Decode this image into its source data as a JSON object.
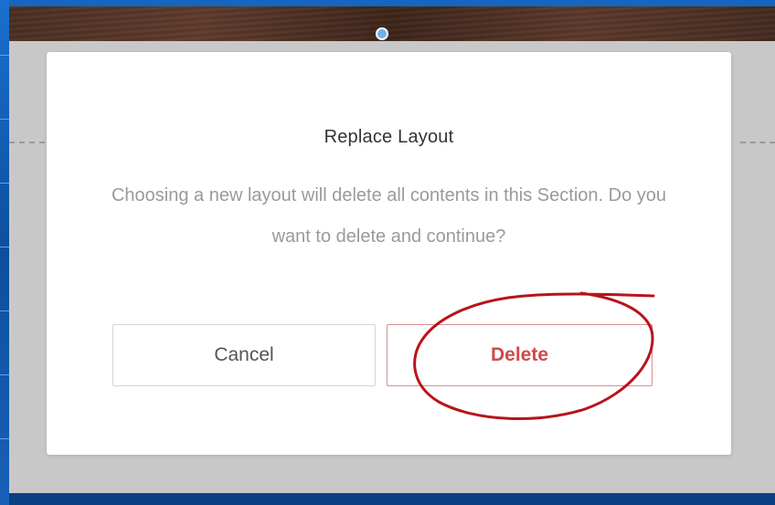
{
  "dialog": {
    "title": "Replace Layout",
    "message": "Choosing a new layout will delete all contents in this Section. Do you want to delete and continue?",
    "cancel_label": "Cancel",
    "delete_label": "Delete"
  },
  "colors": {
    "desktop_blue": "#0d57a8",
    "backdrop_gray": "#c8c8c8",
    "modal_bg": "#ffffff",
    "title_text": "#333333",
    "message_text": "#9a9a9a",
    "delete_red": "#d0494a",
    "delete_border": "#d98f8f",
    "annotation_red": "#b8141a",
    "connector_blue": "#6fb0ea"
  },
  "icons": {
    "connector": "connector-dot-icon"
  }
}
